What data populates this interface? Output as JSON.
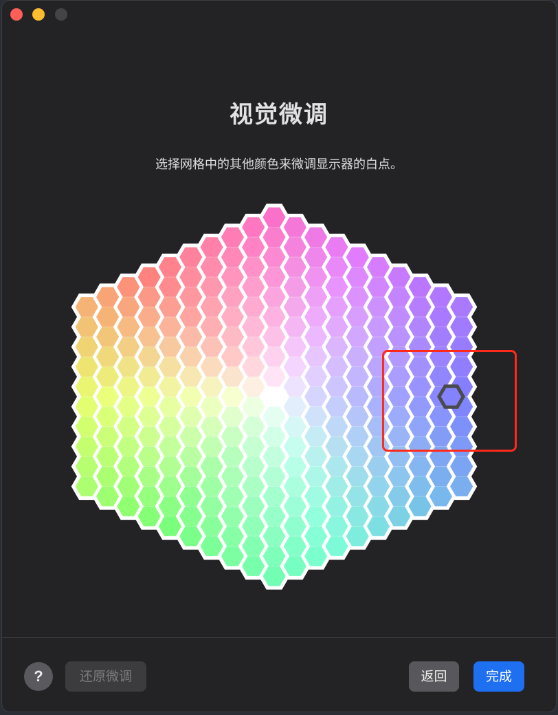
{
  "window": {
    "title": "视觉微调",
    "subtitle": "选择网格中的其他颜色来微调显示器的白点。"
  },
  "traffic_lights": {
    "close_color": "#ff5f57",
    "minimize_color": "#febc2e",
    "zoom_color": "#444447"
  },
  "color_grid": {
    "rings": 9,
    "selected_cell": "blue-violet, right edge of grid",
    "center_color": "#ffffff",
    "hue_colors": {
      "top": "#ff6fc0",
      "top-left": "#ff7a7a",
      "left": "#e8ff70",
      "bottom-left": "#70ff70",
      "bottom": "#70ffd4",
      "right": "#8080ff",
      "top-right": "#e070ff"
    }
  },
  "footer": {
    "help_label": "?",
    "restore_label": "还原微调",
    "back_label": "返回",
    "done_label": "完成"
  },
  "colors": {
    "window_bg": "#232326",
    "done_button": "#1f6ff1",
    "highlight_box": "#ff2a1a"
  }
}
